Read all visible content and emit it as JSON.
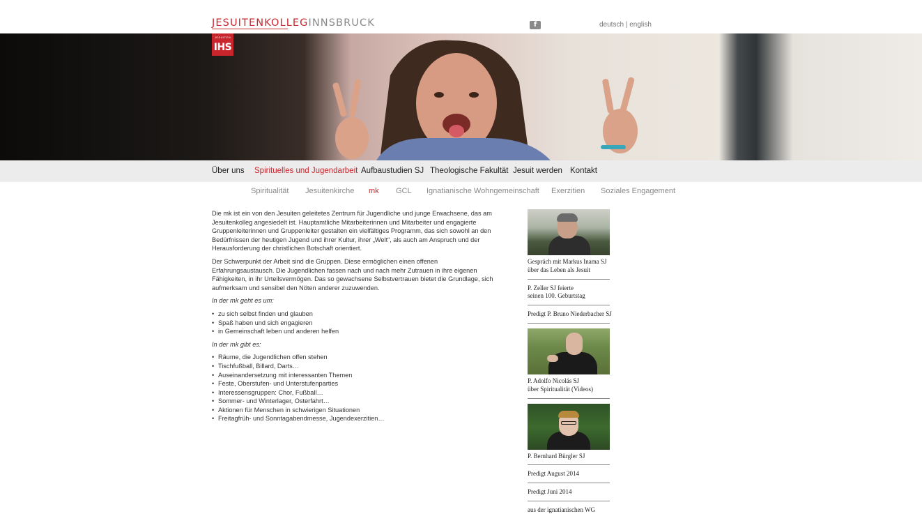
{
  "header": {
    "logo_part1": "JESUITENKOLLEG",
    "logo_part2": "INNSBRUCK",
    "facebook_glyph": "f",
    "lang_de": "deutsch",
    "lang_sep": "|",
    "lang_en": "english"
  },
  "badge": {
    "top": "JESUITEN",
    "main": "IHS"
  },
  "colors": {
    "accent": "#c8262c",
    "nav_bg": "#ececec",
    "muted": "#888888"
  },
  "main_nav": [
    {
      "label": "Über uns",
      "active": false
    },
    {
      "label": "Spirituelles und Jugendarbeit",
      "active": true
    },
    {
      "label": "Aufbaustudien SJ",
      "active": false
    },
    {
      "label": "Theologische Fakultät",
      "active": false
    },
    {
      "label": "Jesuit werden",
      "active": false
    },
    {
      "label": "Kontakt",
      "active": false
    }
  ],
  "sub_nav": [
    {
      "label": "Spiritualität",
      "active": false
    },
    {
      "label": "Jesuitenkirche",
      "active": false
    },
    {
      "label": "mk",
      "active": true
    },
    {
      "label": "GCL",
      "active": false
    },
    {
      "label": "Ignatianische Wohngemeinschaft",
      "active": false
    },
    {
      "label": "Exerzitien",
      "active": false
    },
    {
      "label": "Soziales Engagement",
      "active": false
    }
  ],
  "content": {
    "para1": "Die mk ist ein von den Jesuiten geleitetes Zentrum für Jugendliche und junge Erwachsene, das am Jesuitenkolleg angesiedelt ist. Hauptamtliche Mitarbeiterinnen und Mitarbeiter und engagierte Gruppenleiterinnen und Gruppenleiter gestalten ein vielfältiges Programm, das sich sowohl an den Bedürfnissen der heutigen Jugend und ihrer Kultur, ihrer „Welt“, als auch am Anspruch und der Herausforderung der christlichen Botschaft orientiert.",
    "para2": "Der Schwerpunkt der Arbeit sind die Gruppen. Diese ermöglichen einen offenen Erfahrungsaustausch. Die Jugendlichen fassen nach und nach mehr Zutrauen in ihre eigenen Fähigkeiten, in ihr Urteilsvermögen. Das so gewachsene Selbstvertrauen bietet die Grundlage, sich aufmerksam und sensibel den Nöten anderer zuzuwenden.",
    "heading1": "In der mk geht es um:",
    "list1": [
      "zu sich selbst finden und glauben",
      "Spaß haben und sich engagieren",
      "in Gemeinschaft leben und anderen helfen"
    ],
    "heading2": "In der mk gibt es:",
    "list2": [
      "Räume, die Jugendlichen offen stehen",
      "Tischfußball, Billard, Darts…",
      "Auseinandersetzung mit interessanten Themen",
      "Feste, Oberstufen- und Unterstufenparties",
      "Interessensgruppen: Chor, Fußball…",
      "Sommer- und Winterlager, Osterfahrt…",
      "Aktionen für Menschen in schwierigen Situationen",
      "Freitagfrüh- und Sonntagabendmesse, Jugendexerzitien…"
    ]
  },
  "sidebar": [
    {
      "line1": "Gespräch mit Markus Inama SJ",
      "line2": "über das Leben als Jesuit"
    },
    {
      "line1": "P. Zeller SJ feierte",
      "line2": "seinen 100. Geburtstag"
    },
    {
      "line1": "Predigt P. Bruno Niederbacher SJ"
    },
    {
      "line1": "P. Adolfo Nicolás SJ",
      "line2": "über Spiritualität (Videos)"
    },
    {
      "line1": "P. Bernhard Bürgler SJ"
    },
    {
      "line1": "Predigt August 2014"
    },
    {
      "line1": "Predigt Juni 2014"
    },
    {
      "line1": "aus der ignatianischen WG"
    }
  ]
}
